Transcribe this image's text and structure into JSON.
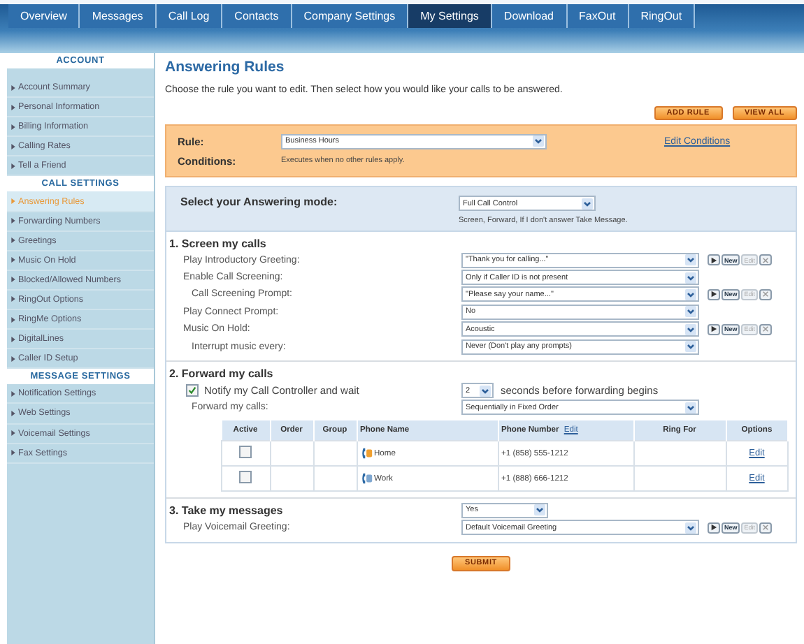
{
  "tabs": [
    {
      "label": "Overview",
      "selected": false
    },
    {
      "label": "Messages",
      "selected": false
    },
    {
      "label": "Call Log",
      "selected": false
    },
    {
      "label": "Contacts",
      "selected": false
    },
    {
      "label": "Company Settings",
      "selected": false
    },
    {
      "label": "My Settings",
      "selected": true
    },
    {
      "label": "Download",
      "selected": false
    },
    {
      "label": "FaxOut",
      "selected": false
    },
    {
      "label": "RingOut",
      "selected": false
    }
  ],
  "sidebar": {
    "groups": [
      {
        "heading": "ACCOUNT",
        "items": [
          {
            "label": "Account Summary",
            "selected": false
          },
          {
            "label": "Personal Information",
            "selected": false
          },
          {
            "label": "Billing Information",
            "selected": false
          },
          {
            "label": "Calling Rates",
            "selected": false
          },
          {
            "label": "Tell a Friend",
            "selected": false
          }
        ]
      },
      {
        "heading": "CALL SETTINGS",
        "items": [
          {
            "label": "Answering Rules",
            "selected": true
          },
          {
            "label": "Forwarding Numbers",
            "selected": false
          },
          {
            "label": "Greetings",
            "selected": false
          },
          {
            "label": "Music On Hold",
            "selected": false
          },
          {
            "label": "Blocked/Allowed Numbers",
            "selected": false
          },
          {
            "label": "RingOut Options",
            "selected": false
          },
          {
            "label": "RingMe Options",
            "selected": false
          },
          {
            "label": "DigitalLines",
            "selected": false
          },
          {
            "label": "Caller ID Setup",
            "selected": false
          }
        ]
      },
      {
        "heading": "MESSAGE SETTINGS",
        "items": [
          {
            "label": "Notification Settings",
            "selected": false
          },
          {
            "label": "Web Settings",
            "selected": false
          },
          {
            "label": "Voicemail Settings",
            "selected": false
          },
          {
            "label": "Fax Settings",
            "selected": false
          }
        ]
      }
    ]
  },
  "page_title": "Answering Rules",
  "intro": "Choose the rule you want to edit. Then select how you would like your calls to be answered.",
  "action_buttons": [
    "ADD RULE",
    "VIEW ALL"
  ],
  "rule": {
    "label": "Rule:",
    "value": "Business Hours",
    "edit_link": "Edit Conditions",
    "conditions_label": "Conditions:",
    "conditions_text": "Executes when no other rules apply."
  },
  "mode": {
    "label": "Select your Answering mode:",
    "value": "Full Call Control",
    "hint": "Screen, Forward, If I don't answer Take Message."
  },
  "screen_section": {
    "title": "1. Screen my calls",
    "rows": [
      {
        "label": "Play Introductory Greeting:",
        "value": "\"Thank you for calling...\"",
        "media": {
          "new": "New",
          "edit": "Edit",
          "edit_disabled": true
        }
      },
      {
        "label": "Enable Call Screening:",
        "value": "Only if Caller ID is not present",
        "children": [
          {
            "label": "Call Screening Prompt:",
            "value": "\"Please say your name...\"",
            "media": {
              "new": "New",
              "edit": "Edit",
              "edit_disabled": true
            }
          }
        ]
      },
      {
        "label": "Play Connect Prompt:",
        "value": "No"
      },
      {
        "label": "Music On Hold:",
        "value": "Acoustic",
        "media": {
          "new": "New",
          "edit": "Edit",
          "edit_disabled": true
        },
        "children": [
          {
            "label": "Interrupt music every:",
            "value": "Never (Don't play any prompts)"
          }
        ]
      }
    ]
  },
  "forward_section": {
    "title": "2. Forward my calls",
    "notify": {
      "checked": true,
      "label": "Notify my Call Controller and wait",
      "seconds": "2",
      "suffix": "seconds before forwarding begins"
    },
    "forward_label": "Forward my calls:",
    "forward_value": "Sequentially in Fixed Order",
    "table": {
      "columns": [
        "Active",
        "Order",
        "Group",
        "Phone Name",
        "Phone Number",
        "Ring For",
        "Options"
      ],
      "number_edit": "Edit",
      "rows": [
        {
          "active": false,
          "name": "Home",
          "number": "+1 (858) 555-1212",
          "option": "Edit"
        },
        {
          "active": false,
          "name": "Work",
          "number": "+1 (888) 666-1212",
          "option": "Edit"
        }
      ]
    }
  },
  "messages_section": {
    "title": "3. Take my messages",
    "value": "Yes",
    "rows": [
      {
        "label": "Play Voicemail Greeting:",
        "value": "Default Voicemail Greeting",
        "media": {
          "new": "New",
          "edit": "Edit",
          "edit_disabled": true
        }
      }
    ]
  },
  "submit": "SUBMIT"
}
